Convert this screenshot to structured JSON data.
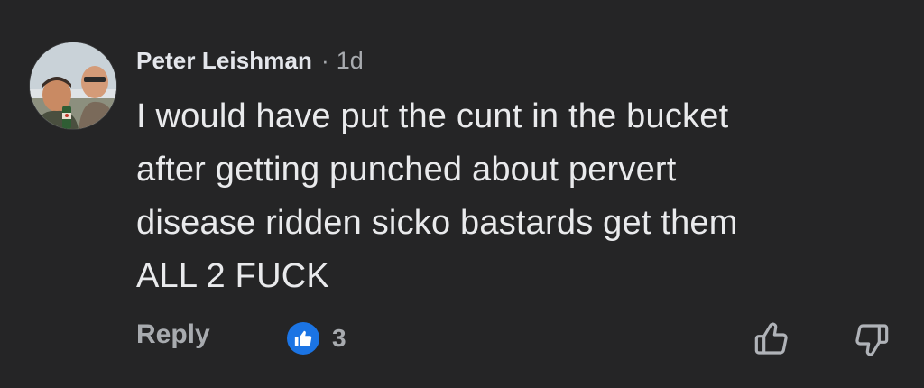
{
  "comment": {
    "author": "Peter Leishman",
    "separator": "·",
    "time": "1d",
    "text_lines": [
      "I would have put the cunt in the bucket",
      "after getting punched about pervert",
      "disease ridden sicko bastards get them",
      "ALL 2 FUCK"
    ],
    "reply_label": "Reply",
    "like_count": "3"
  },
  "icons": {
    "like_badge": "thumbs-up-icon",
    "upvote": "thumbs-up-outline-icon",
    "downvote": "thumbs-down-outline-icon"
  },
  "colors": {
    "background": "#252526",
    "primary_text": "#e4e6eb",
    "secondary_text": "#a8abaf",
    "like_blue": "#1b74e4"
  }
}
